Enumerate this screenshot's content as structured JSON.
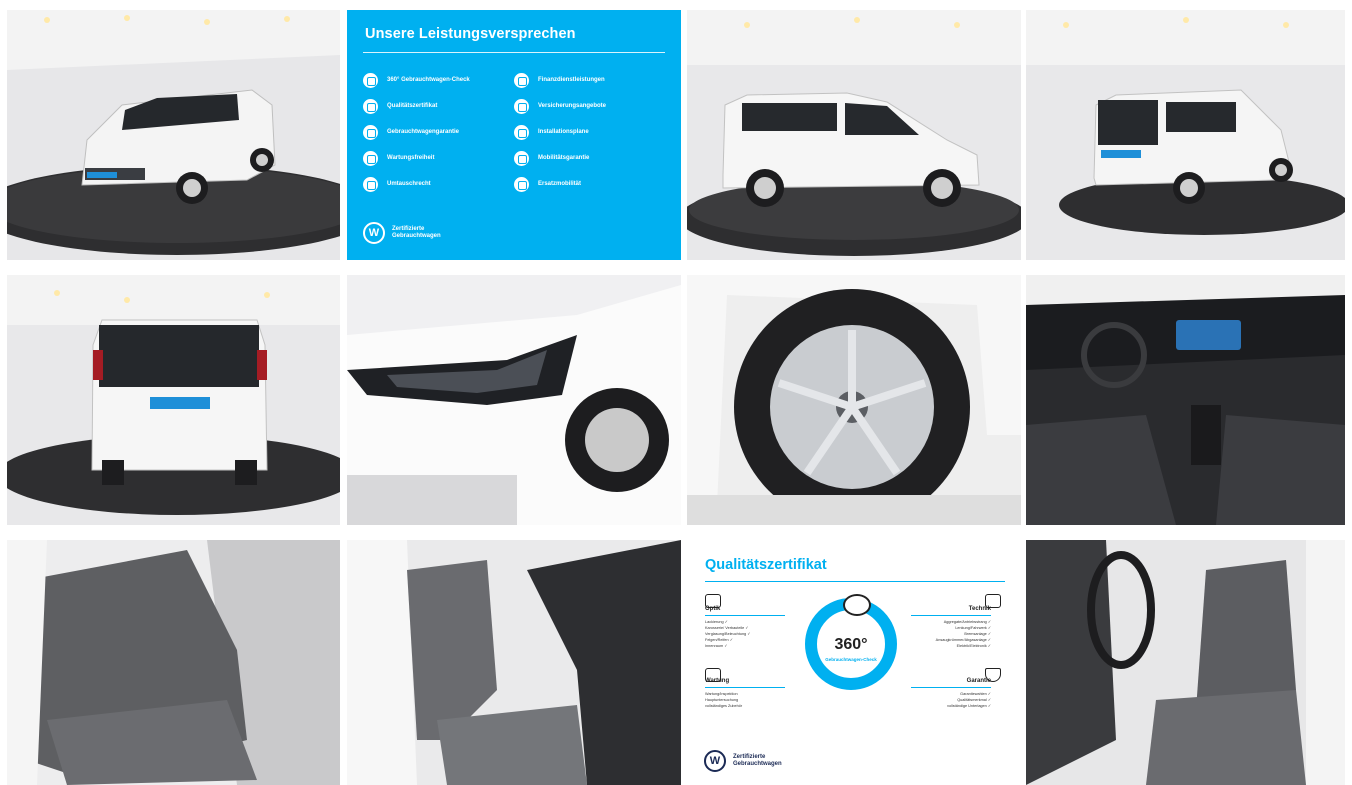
{
  "gallery": {
    "photos": [
      {
        "icon": "car-front-left-photo"
      },
      {
        "icon": "car-side-photo"
      },
      {
        "icon": "car-rear-right-photo"
      },
      {
        "icon": "car-rear-photo"
      },
      {
        "icon": "headlight-photo"
      },
      {
        "icon": "wheel-photo"
      },
      {
        "icon": "dashboard-photo"
      },
      {
        "icon": "rear-seats-photo"
      },
      {
        "icon": "front-seats-photo"
      },
      {
        "icon": "driver-seat-photo"
      }
    ]
  },
  "promise": {
    "title": "Unsere Leistungsversprechen",
    "left_items": [
      "360° Gebrauchtwagen-Check",
      "Qualitätszertifikat",
      "Gebrauchtwagengarantie",
      "Wartungsfreiheit",
      "Umtauschrecht"
    ],
    "right_items": [
      "Finanzdienstleistungen",
      "Versicherungsangebote",
      "Installationsplane",
      "Mobilitätsgarantie",
      "Ersatzmobilität"
    ],
    "brand_line1": "Zertifizierte",
    "brand_line2": "Gebrauchtwagen",
    "colors": {
      "background": "#00b0f0"
    }
  },
  "quality": {
    "title": "Qualitätszertifikat",
    "ring_number": "360°",
    "ring_text": "Gebrauchtwagen-Check",
    "optik": {
      "title": "Optik",
      "lines": [
        "Lackierung ✓",
        "Karosserie/ Verbauteile ✓",
        "Verglasung/Beleuchtung ✓",
        "Felgen/Reifen ✓",
        "Innenraum ✓"
      ]
    },
    "technik": {
      "title": "Technik",
      "lines": [
        "Aggregate/Antriebsstrang ✓",
        "Lenkung/Fahrwerk ✓",
        "Bremsanlage ✓",
        "Ansaugkrümmer/Abgasanlage ✓",
        "Elektrik/Elektronik ✓"
      ]
    },
    "wartung": {
      "title": "Wartung",
      "lines": [
        "Wartung/Inspektion",
        "Hauptuntersuchung",
        "vollständiges Zubehör"
      ]
    },
    "garantie": {
      "title": "Garantie",
      "lines": [
        "Garantiewahlen ✓",
        "Qualitätsmerkmal ✓",
        "vollständige Unterlagen ✓"
      ]
    },
    "brand_line1": "Zertifizierte",
    "brand_line2": "Gebrauchtwagen",
    "colors": {
      "accent": "#00b0f0"
    }
  }
}
